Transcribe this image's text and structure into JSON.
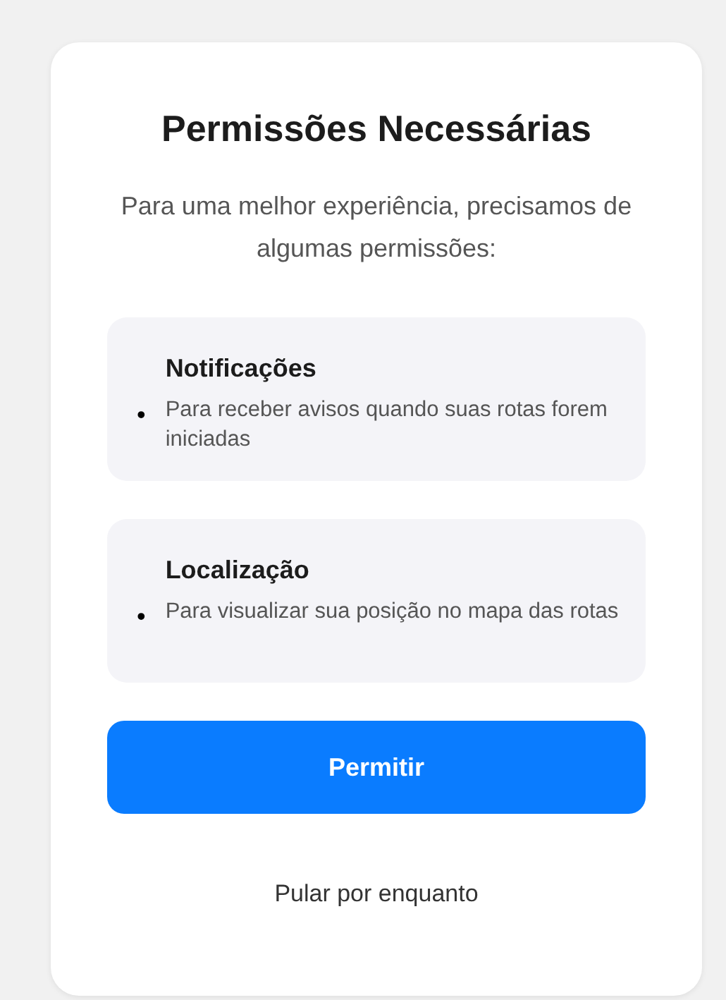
{
  "dialog": {
    "title": "Permissões Necessárias",
    "subtitle": "Para uma melhor experiência, precisamos de algumas permissões:",
    "permissions": [
      {
        "marker": "•",
        "title": "Notificações",
        "description": "Para receber avisos quando suas rotas forem iniciadas"
      },
      {
        "marker": "•",
        "title": "Localização",
        "description": "Para visualizar sua posição no mapa das rotas"
      }
    ],
    "primary_button": "Permitir",
    "secondary_link": "Pular por enquanto"
  }
}
